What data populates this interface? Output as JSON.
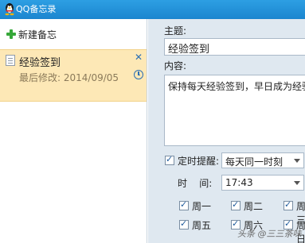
{
  "window": {
    "title": "QQ备忘录"
  },
  "sidebar": {
    "new_note_label": "新建备忘",
    "notes": [
      {
        "title": "经验签到",
        "modified": "最后修改: 2014/09/05"
      }
    ]
  },
  "editor": {
    "subject_label": "主题:",
    "subject_value": "经验签到",
    "content_label": "内容:",
    "content_value": "保持每天经验签到，早日成为经验大",
    "reminder_label": "定时提醒:",
    "reminder_value": "每天同一时刻",
    "time_label": "时    间:",
    "time_value": "17:43",
    "days": [
      {
        "label": "周一",
        "checked": true
      },
      {
        "label": "周二",
        "checked": true
      },
      {
        "label": "周三",
        "checked": true
      },
      {
        "label": "周五",
        "checked": true
      },
      {
        "label": "周六",
        "checked": true
      },
      {
        "label": "周日",
        "checked": true
      }
    ]
  },
  "watermark": "头条 @三三茶味"
}
